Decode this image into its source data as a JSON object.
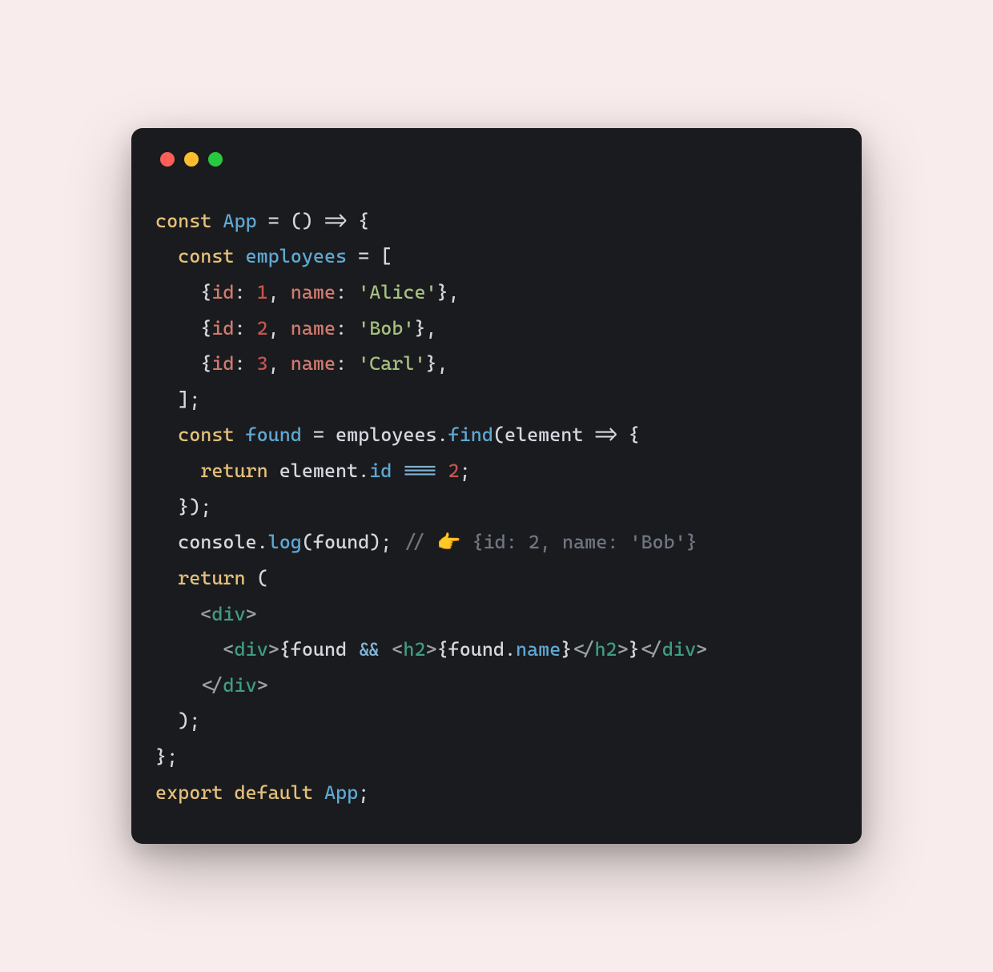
{
  "window": {
    "traffic_lights": [
      "red",
      "yellow",
      "green"
    ]
  },
  "code": {
    "l1": {
      "kw_const": "const",
      "def": "App",
      "eq": " = ",
      "arrow": "() => {",
      "open": ""
    },
    "l2": {
      "kw_const": "const",
      "def": "employees",
      "eq": " = ["
    },
    "l3": {
      "open": "{",
      "p1": "id",
      "c1": ": ",
      "n1": "1",
      "c2": ", ",
      "p2": "name",
      "c3": ": ",
      "s1": "'Alice'",
      "close": "},"
    },
    "l4": {
      "open": "{",
      "p1": "id",
      "c1": ": ",
      "n1": "2",
      "c2": ", ",
      "p2": "name",
      "c3": ": ",
      "s1": "'Bob'",
      "close": "},"
    },
    "l5": {
      "open": "{",
      "p1": "id",
      "c1": ": ",
      "n1": "3",
      "c2": ", ",
      "p2": "name",
      "c3": ": ",
      "s1": "'Carl'",
      "close": "},"
    },
    "l6": {
      "close": "];"
    },
    "l7": {
      "kw_const": "const",
      "def": "found",
      "eq": " = ",
      "obj": "employees",
      "dot": ".",
      "method": "find",
      "open": "(",
      "param": "element",
      "arrow": " => {",
      "end": ""
    },
    "l8": {
      "kw_return": "return",
      "sp": " ",
      "obj": "element",
      "dot": ".",
      "prop": "id",
      "op": " === ",
      "num": "2",
      "semi": ";"
    },
    "l9": {
      "close": "});"
    },
    "l10": {
      "obj": "console",
      "dot": ".",
      "method": "log",
      "open": "(",
      "arg": "found",
      "close": "); ",
      "comment_slashes": "// ",
      "emoji": "👉",
      "comment_rest": " {id: 2, name: 'Bob'}"
    },
    "l11": {
      "kw_return": "return",
      "open": " ("
    },
    "l12": {
      "tag_open": "<",
      "tag": "div",
      "tag_close": ">"
    },
    "l13": {
      "t1o": "<",
      "t1": "div",
      "t1c": ">",
      "lb": "{",
      "expr1": "found",
      "op": " && ",
      "t2o": "<",
      "t2": "h2",
      "t2c": ">",
      "lb2": "{",
      "expr2": "found",
      "dot": ".",
      "prop": "name",
      "rb2": "}",
      "t2co": "</",
      "t2e": "h2",
      "t2cc": ">",
      "rb": "}",
      "t1co": "</",
      "t1e": "div",
      "t1cc": ">"
    },
    "l14": {
      "tag_open": "</",
      "tag": "div",
      "tag_close": ">"
    },
    "l15": {
      "close": ");"
    },
    "l16": {
      "close": "};"
    },
    "l17": {
      "kw_export": "export",
      "sp": " ",
      "kw_default": "default",
      "sp2": " ",
      "def": "App",
      "semi": ";"
    }
  }
}
